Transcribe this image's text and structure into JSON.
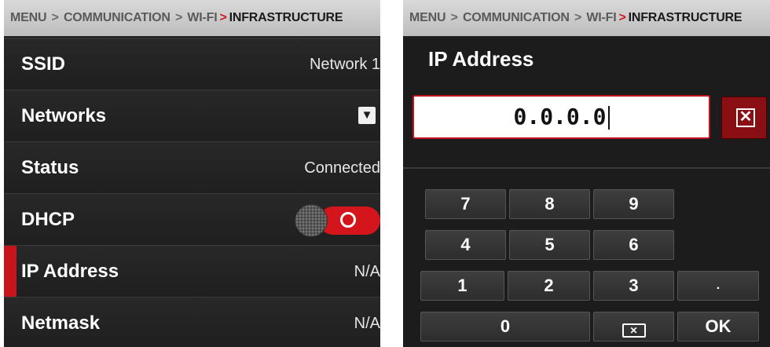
{
  "left_panel": {
    "breadcrumb": [
      "MENU",
      "COMMUNICATION",
      "WI-FI",
      "INFRASTRUCTURE"
    ],
    "rows": [
      {
        "label": "SSID",
        "value": "Network 1"
      },
      {
        "label": "Networks",
        "value": ""
      },
      {
        "label": "Status",
        "value": "Connected"
      },
      {
        "label": "DHCP",
        "value": "",
        "toggle_on": true
      },
      {
        "label": "IP Address",
        "value": "N/A",
        "selected": true
      },
      {
        "label": "Netmask",
        "value": "N/A"
      }
    ],
    "dropdown_icon": "▼"
  },
  "right_panel": {
    "breadcrumb": [
      "MENU",
      "COMMUNICATION",
      "WI-FI",
      "INFRASTRUCTURE"
    ],
    "title": "IP Address",
    "ip_value": "0.0.0.0",
    "clear_icon": "✕",
    "keypad": {
      "row1": [
        "7",
        "8",
        "9"
      ],
      "row2": [
        "4",
        "5",
        "6"
      ],
      "row3": [
        "1",
        "2",
        "3",
        "."
      ],
      "zero": "0",
      "backspace_icon": "✕",
      "ok": "OK"
    }
  },
  "colors": {
    "accent": "#c8141c",
    "panel_bg": "#1c1c1c",
    "breadcrumb_bg": "#cccccc"
  }
}
